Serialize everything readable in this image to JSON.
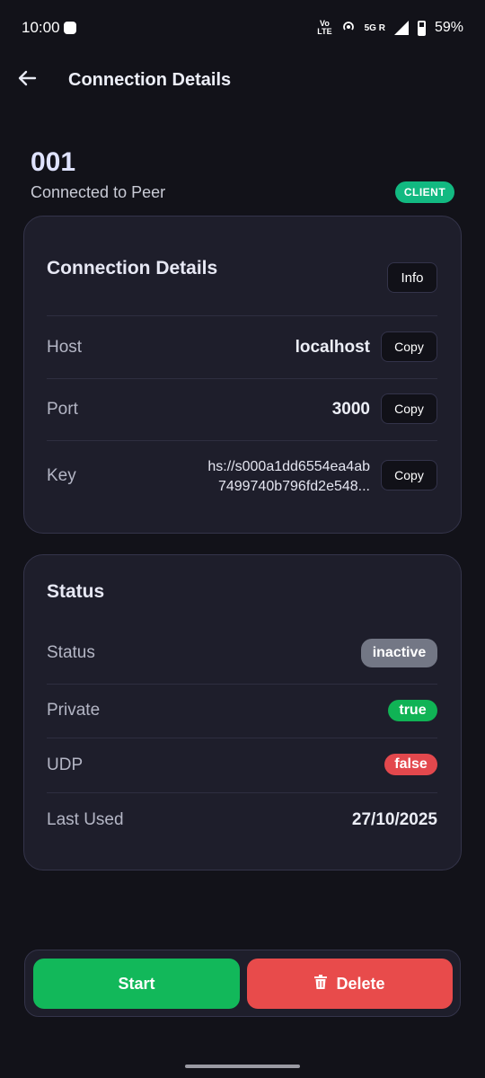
{
  "status_bar": {
    "time": "10:00",
    "volte": "Vo LTE",
    "network": "5G R",
    "battery": "59%"
  },
  "app_bar": {
    "title": "Connection Details",
    "back_icon": "arrow-left-icon"
  },
  "header": {
    "id": "001",
    "subtitle": "Connected to Peer",
    "badge": "CLIENT"
  },
  "connection_card": {
    "title": "Connection Details",
    "info_label": "Info",
    "rows": [
      {
        "label": "Host",
        "value": "localhost",
        "copy_label": "Copy"
      },
      {
        "label": "Port",
        "value": "3000",
        "copy_label": "Copy"
      },
      {
        "label": "Key",
        "value_line1": "hs://s000a1dd6554ea4ab",
        "value_line2": "7499740b796fd2e548...",
        "copy_label": "Copy"
      }
    ]
  },
  "status_card": {
    "title": "Status",
    "rows": [
      {
        "label": "Status",
        "value": "inactive"
      },
      {
        "label": "Private",
        "value": "true"
      },
      {
        "label": "UDP",
        "value": "false"
      },
      {
        "label": "Last Used",
        "value": "27/10/2025"
      }
    ]
  },
  "actions": {
    "start_label": "Start",
    "delete_label": "Delete",
    "delete_icon": "trash-icon"
  },
  "colors": {
    "background": "#121219",
    "card": "#1e1e2b",
    "accent_green": "#12b85a",
    "accent_red": "#e84b4b",
    "badge_client": "#12b981",
    "pill_inactive": "#737785"
  }
}
